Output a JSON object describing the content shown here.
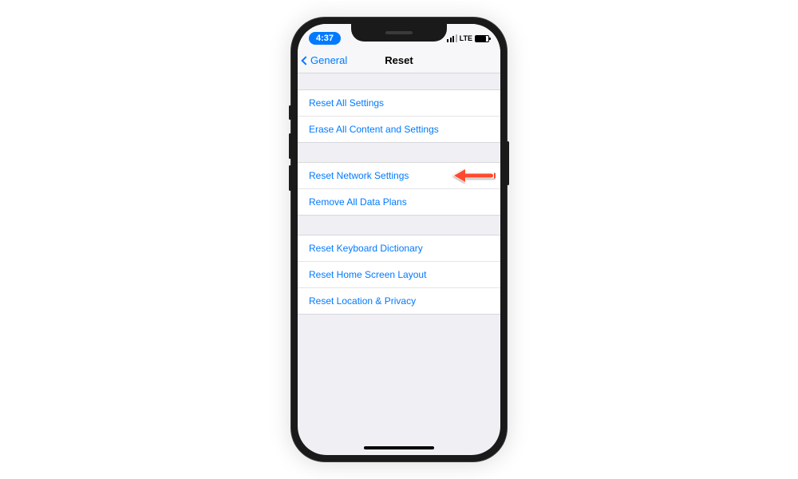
{
  "status": {
    "time": "4:37",
    "network": "LTE"
  },
  "nav": {
    "back_label": "General",
    "title": "Reset"
  },
  "groups": [
    {
      "items": [
        {
          "label": "Reset All Settings"
        },
        {
          "label": "Erase All Content and Settings"
        }
      ]
    },
    {
      "items": [
        {
          "label": "Reset Network Settings",
          "highlighted": true
        },
        {
          "label": "Remove All Data Plans"
        }
      ]
    },
    {
      "items": [
        {
          "label": "Reset Keyboard Dictionary"
        },
        {
          "label": "Reset Home Screen Layout"
        },
        {
          "label": "Reset Location & Privacy"
        }
      ]
    }
  ],
  "arrow_color": "#ff4a2e"
}
